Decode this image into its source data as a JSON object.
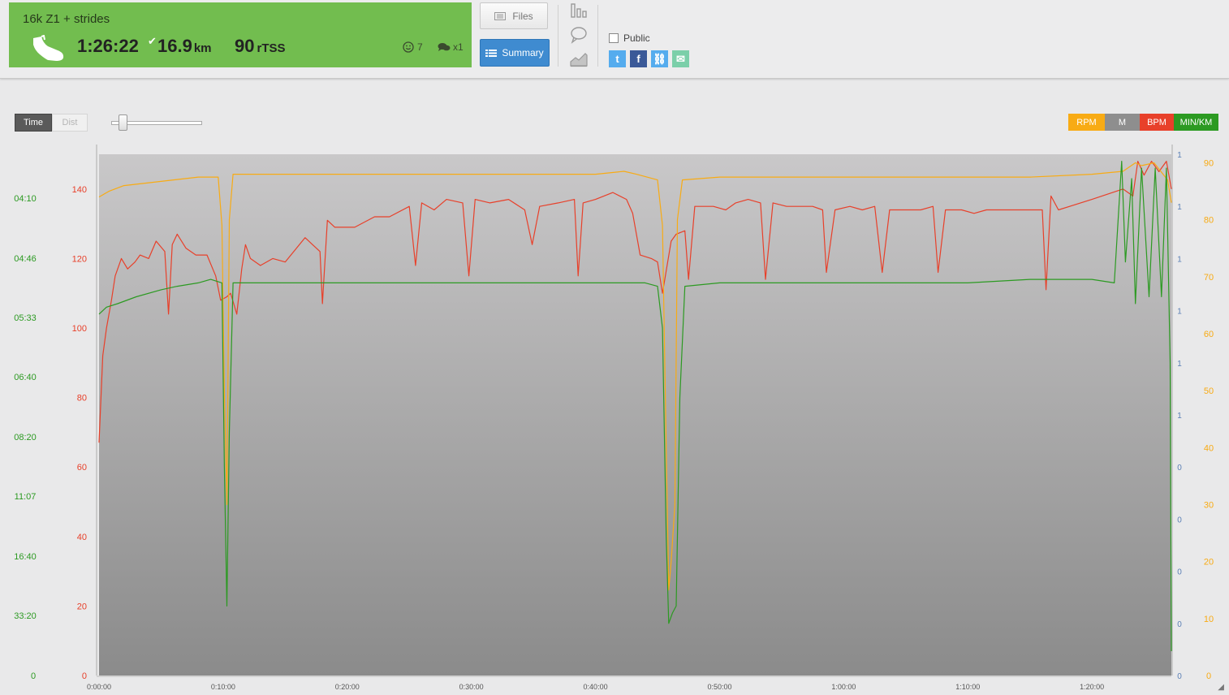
{
  "activity": {
    "title": "16k Z1 + strides",
    "duration": "1:26:22",
    "distance": "16.9",
    "distance_unit": "km",
    "tss": "90",
    "tss_unit": "rTSS",
    "feel": "7",
    "comments": "x1",
    "card_color": "#72bd4f"
  },
  "buttons": {
    "files": "Files",
    "summary": "Summary"
  },
  "sharing": {
    "public_label": "Public",
    "public_checked": false,
    "services": [
      {
        "name": "twitter-icon",
        "glyph": "t",
        "color": "#55acee"
      },
      {
        "name": "facebook-icon",
        "glyph": "f",
        "color": "#3b5998"
      },
      {
        "name": "link-icon",
        "glyph": "⛓",
        "color": "#55acee"
      },
      {
        "name": "email-icon",
        "glyph": "✉",
        "color": "#7bcfa9"
      }
    ]
  },
  "x_mode": {
    "active": "Time",
    "inactive": "Dist"
  },
  "legend": [
    {
      "label": "RPM",
      "color": "#f8ab14"
    },
    {
      "label": "M",
      "color": "#8e8e8e"
    },
    {
      "label": "BPM",
      "color": "#e8402a"
    },
    {
      "label": "MIN/KM",
      "color": "#2c9a22"
    }
  ],
  "chart_data": {
    "type": "line",
    "x_unit": "elapsed time",
    "x_ticks": [
      "0:00:00",
      "0:10:00",
      "0:20:00",
      "0:30:00",
      "0:40:00",
      "0:50:00",
      "1:00:00",
      "1:10:00",
      "1:20:00"
    ],
    "xlim_minutes": [
      0,
      86.4
    ],
    "axes": {
      "pace": {
        "label_color": "#2c9a22",
        "ticks": [
          "04:10",
          "04:46",
          "05:33",
          "06:40",
          "08:20",
          "11:07",
          "16:40",
          "33:20",
          "0"
        ]
      },
      "hr": {
        "label_color": "#e8402a",
        "ticks": [
          "140",
          "120",
          "100",
          "80",
          "60",
          "40",
          "20",
          "0"
        ],
        "ylim": [
          0,
          150
        ]
      },
      "elev": {
        "label_color": "#5a7fb5",
        "ticks": [
          "1",
          "1",
          "1",
          "1",
          "1",
          "1",
          "0",
          "0",
          "0",
          "0",
          "0"
        ]
      },
      "cadence": {
        "label_color": "#f8ab14",
        "ticks": [
          "90",
          "80",
          "70",
          "60",
          "50",
          "40",
          "30",
          "20",
          "10",
          "0"
        ],
        "ylim": [
          0,
          91.5
        ]
      }
    },
    "series": [
      {
        "name": "BPM",
        "color": "#e8402a",
        "points": [
          [
            0,
            67
          ],
          [
            0.3,
            92
          ],
          [
            0.6,
            100
          ],
          [
            1,
            108
          ],
          [
            1.3,
            115
          ],
          [
            1.8,
            120
          ],
          [
            2.3,
            117
          ],
          [
            2.9,
            119
          ],
          [
            3.3,
            121
          ],
          [
            4,
            120
          ],
          [
            4.6,
            125
          ],
          [
            5.3,
            122
          ],
          [
            5.6,
            104
          ],
          [
            5.9,
            124
          ],
          [
            6.3,
            127
          ],
          [
            7,
            123
          ],
          [
            7.8,
            121
          ],
          [
            8.7,
            121
          ],
          [
            9.4,
            115
          ],
          [
            9.8,
            108
          ],
          [
            10.3,
            109
          ],
          [
            10.6,
            110
          ],
          [
            11.1,
            104
          ],
          [
            11.5,
            117
          ],
          [
            11.8,
            124
          ],
          [
            12.2,
            120
          ],
          [
            13,
            118
          ],
          [
            14,
            120
          ],
          [
            15,
            119
          ],
          [
            16.6,
            126
          ],
          [
            17.8,
            122
          ],
          [
            18,
            107
          ],
          [
            18.4,
            131
          ],
          [
            19,
            129
          ],
          [
            20.6,
            129
          ],
          [
            22.2,
            132
          ],
          [
            23.4,
            132
          ],
          [
            25,
            135
          ],
          [
            25.5,
            118
          ],
          [
            26,
            136
          ],
          [
            27,
            134
          ],
          [
            28,
            137
          ],
          [
            29.3,
            136
          ],
          [
            29.8,
            115
          ],
          [
            30.3,
            137
          ],
          [
            31.5,
            136
          ],
          [
            33,
            137
          ],
          [
            34.3,
            134
          ],
          [
            34.9,
            124
          ],
          [
            35.5,
            135
          ],
          [
            37,
            136
          ],
          [
            38.3,
            137
          ],
          [
            38.6,
            115
          ],
          [
            39,
            136
          ],
          [
            40,
            137
          ],
          [
            41.4,
            139
          ],
          [
            42.5,
            137
          ],
          [
            43,
            133
          ],
          [
            43.6,
            121
          ],
          [
            44.5,
            120
          ],
          [
            45,
            119
          ],
          [
            45.4,
            110
          ],
          [
            46.1,
            125
          ],
          [
            46.5,
            127
          ],
          [
            47.2,
            128
          ],
          [
            47.5,
            114
          ],
          [
            48,
            135
          ],
          [
            49.5,
            135
          ],
          [
            50.5,
            134
          ],
          [
            51.3,
            136
          ],
          [
            52.3,
            137
          ],
          [
            53.3,
            136
          ],
          [
            53.7,
            114
          ],
          [
            54.3,
            136
          ],
          [
            55.4,
            135
          ],
          [
            56.5,
            135
          ],
          [
            57.5,
            135
          ],
          [
            58.3,
            134
          ],
          [
            58.6,
            116
          ],
          [
            59.3,
            134
          ],
          [
            60.5,
            135
          ],
          [
            61.5,
            134
          ],
          [
            62.5,
            135
          ],
          [
            63.1,
            116
          ],
          [
            63.7,
            134
          ],
          [
            65.1,
            134
          ],
          [
            66.2,
            134
          ],
          [
            67.2,
            135
          ],
          [
            67.6,
            116
          ],
          [
            68.2,
            134
          ],
          [
            69.5,
            134
          ],
          [
            70.5,
            133
          ],
          [
            71.5,
            134
          ],
          [
            72.6,
            134
          ],
          [
            73.5,
            134
          ],
          [
            76,
            134
          ],
          [
            76.3,
            111
          ],
          [
            76.7,
            138
          ],
          [
            77.3,
            134
          ],
          [
            80,
            137
          ],
          [
            82.5,
            140
          ],
          [
            83.3,
            138
          ],
          [
            83.7,
            148
          ],
          [
            84.2,
            144
          ],
          [
            84.8,
            148
          ],
          [
            85.4,
            145
          ],
          [
            86,
            148
          ],
          [
            86.4,
            140
          ]
        ]
      },
      {
        "name": "RPM",
        "color": "#f8ab14",
        "points": [
          [
            0,
            84
          ],
          [
            0.8,
            85
          ],
          [
            2,
            86
          ],
          [
            4,
            86.5
          ],
          [
            6,
            87
          ],
          [
            8,
            87.5
          ],
          [
            9.6,
            87.5
          ],
          [
            9.9,
            79
          ],
          [
            10.1,
            50
          ],
          [
            10.3,
            30
          ],
          [
            10.5,
            80
          ],
          [
            10.8,
            88
          ],
          [
            13,
            88
          ],
          [
            20,
            88
          ],
          [
            30,
            88
          ],
          [
            40,
            88
          ],
          [
            42.3,
            88.5
          ],
          [
            43.3,
            88
          ],
          [
            45,
            87
          ],
          [
            45.4,
            79
          ],
          [
            45.7,
            40
          ],
          [
            45.9,
            15
          ],
          [
            46.1,
            20
          ],
          [
            46.4,
            30
          ],
          [
            46.6,
            80
          ],
          [
            47,
            87
          ],
          [
            50,
            87.5
          ],
          [
            55,
            87.5
          ],
          [
            60,
            87.5
          ],
          [
            65,
            87.5
          ],
          [
            70,
            87.5
          ],
          [
            75,
            87.5
          ],
          [
            80,
            88
          ],
          [
            82.5,
            88.5
          ],
          [
            83.5,
            90
          ],
          [
            84,
            89.5
          ],
          [
            85,
            90
          ],
          [
            86.1,
            87
          ],
          [
            86.4,
            83
          ]
        ]
      },
      {
        "name": "MIN/KM",
        "color": "#2c9a22",
        "points": [
          [
            0,
            104
          ],
          [
            0.6,
            106
          ],
          [
            1.5,
            107
          ],
          [
            3,
            109
          ],
          [
            5,
            111
          ],
          [
            6.3,
            112
          ],
          [
            8,
            113
          ],
          [
            9,
            114
          ],
          [
            9.9,
            113
          ],
          [
            10.1,
            60
          ],
          [
            10.3,
            20
          ],
          [
            10.5,
            70
          ],
          [
            10.8,
            113
          ],
          [
            13,
            113
          ],
          [
            20,
            113
          ],
          [
            30,
            113
          ],
          [
            40,
            113
          ],
          [
            44,
            113
          ],
          [
            45,
            112
          ],
          [
            45.4,
            100
          ],
          [
            45.7,
            40
          ],
          [
            45.9,
            15
          ],
          [
            46.2,
            18
          ],
          [
            46.5,
            20
          ],
          [
            46.8,
            80
          ],
          [
            47.2,
            112
          ],
          [
            50,
            113
          ],
          [
            55,
            113
          ],
          [
            60,
            113
          ],
          [
            65,
            113
          ],
          [
            70,
            113
          ],
          [
            75,
            114
          ],
          [
            80,
            114
          ],
          [
            81.8,
            113
          ],
          [
            82.4,
            148
          ],
          [
            82.7,
            119
          ],
          [
            83.2,
            143
          ],
          [
            83.5,
            107
          ],
          [
            84,
            146
          ],
          [
            84.6,
            109
          ],
          [
            85.1,
            146
          ],
          [
            85.6,
            109
          ],
          [
            86,
            146
          ],
          [
            86.3,
            90
          ],
          [
            86.4,
            7
          ]
        ]
      }
    ]
  }
}
